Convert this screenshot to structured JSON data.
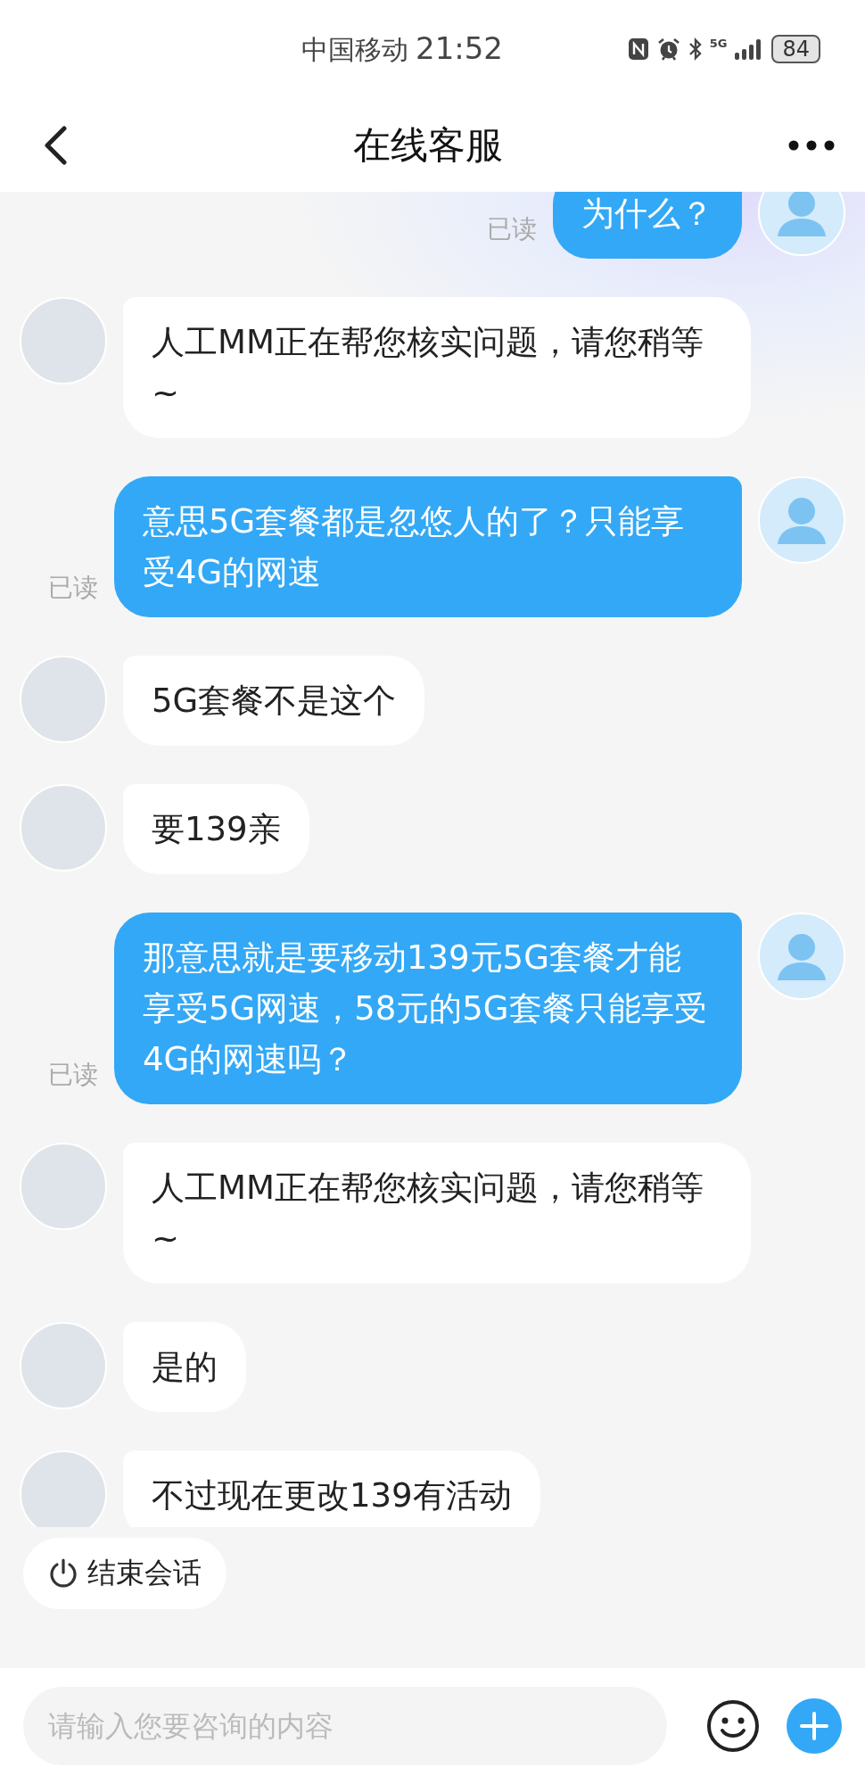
{
  "status_bar": {
    "carrier": "中国移动",
    "time": "21:52",
    "network": "5G",
    "battery": "84"
  },
  "header": {
    "title": "在线客服"
  },
  "messages": [
    {
      "kind": "sent",
      "text": "为什么？",
      "receipt": "已读"
    },
    {
      "kind": "received",
      "text": "人工MM正在帮您核实问题，请您稍等~"
    },
    {
      "kind": "sent",
      "text": "意思5G套餐都是忽悠人的了？只能享受4G的网速",
      "receipt": "已读"
    },
    {
      "kind": "received",
      "text": "5G套餐不是这个"
    },
    {
      "kind": "received",
      "text": "要139亲"
    },
    {
      "kind": "sent",
      "text": "那意思就是要移动139元5G套餐才能享受5G网速，58元的5G套餐只能享受4G的网速吗？",
      "receipt": "已读"
    },
    {
      "kind": "received",
      "text": "人工MM正在帮您核实问题，请您稍等~"
    },
    {
      "kind": "received",
      "text": "是的"
    },
    {
      "kind": "received",
      "text": "不过现在更改139有活动"
    }
  ],
  "end_session_button": "结束会话",
  "input": {
    "placeholder": "请输入您要咨询的内容"
  }
}
